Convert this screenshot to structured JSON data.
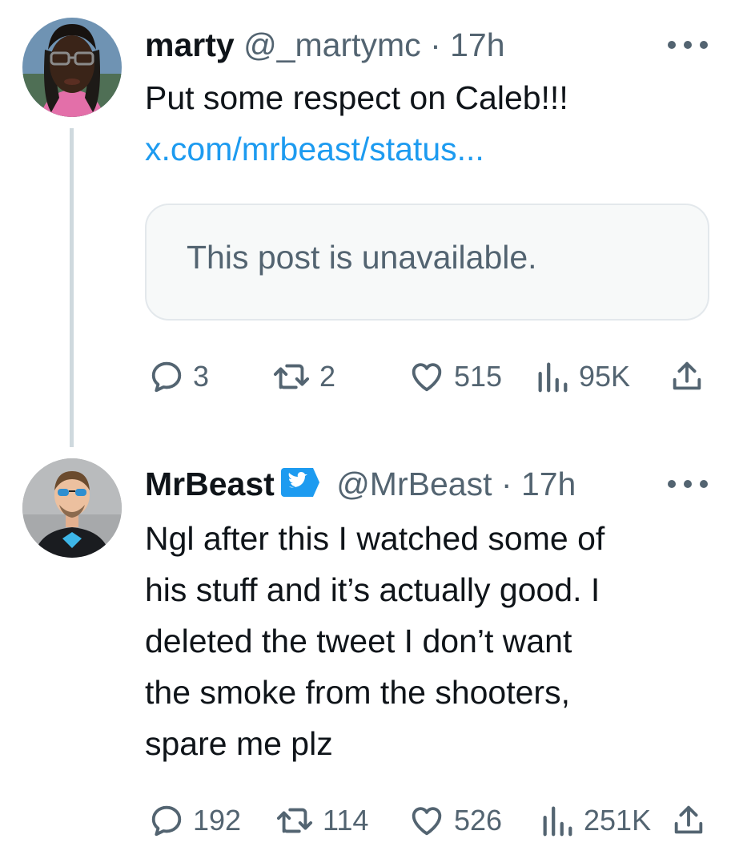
{
  "tweets": [
    {
      "author": {
        "name": "marty",
        "handle": "@_martymc",
        "time": "17h"
      },
      "text_lines": [
        "Put some respect on Caleb!!!"
      ],
      "link": "x.com/mrbeast/status...",
      "quote_unavailable": "This post is unavailable.",
      "stats": {
        "replies": "3",
        "reposts": "2",
        "likes": "515",
        "views": "95K"
      }
    },
    {
      "author": {
        "name": "MrBeast",
        "handle": "@MrBeast",
        "time": "17h",
        "verified": true
      },
      "text_lines": [
        "Ngl after this I watched some of",
        "his stuff and it’s actually good. I",
        "deleted the tweet I don’t want",
        "the smoke from the shooters,",
        "spare me plz"
      ],
      "stats": {
        "replies": "192",
        "reposts": "114",
        "likes": "526",
        "views": "251K"
      }
    }
  ],
  "separator": "·",
  "colors": {
    "link": "#1d9bf0",
    "secondary_text": "#536471",
    "verified_badge": "#1d9bf0",
    "thread_line": "#cfd9de"
  },
  "icons": [
    "more-icon",
    "reply-icon",
    "repost-icon",
    "like-icon",
    "views-icon",
    "share-icon",
    "verified-badge-icon"
  ]
}
